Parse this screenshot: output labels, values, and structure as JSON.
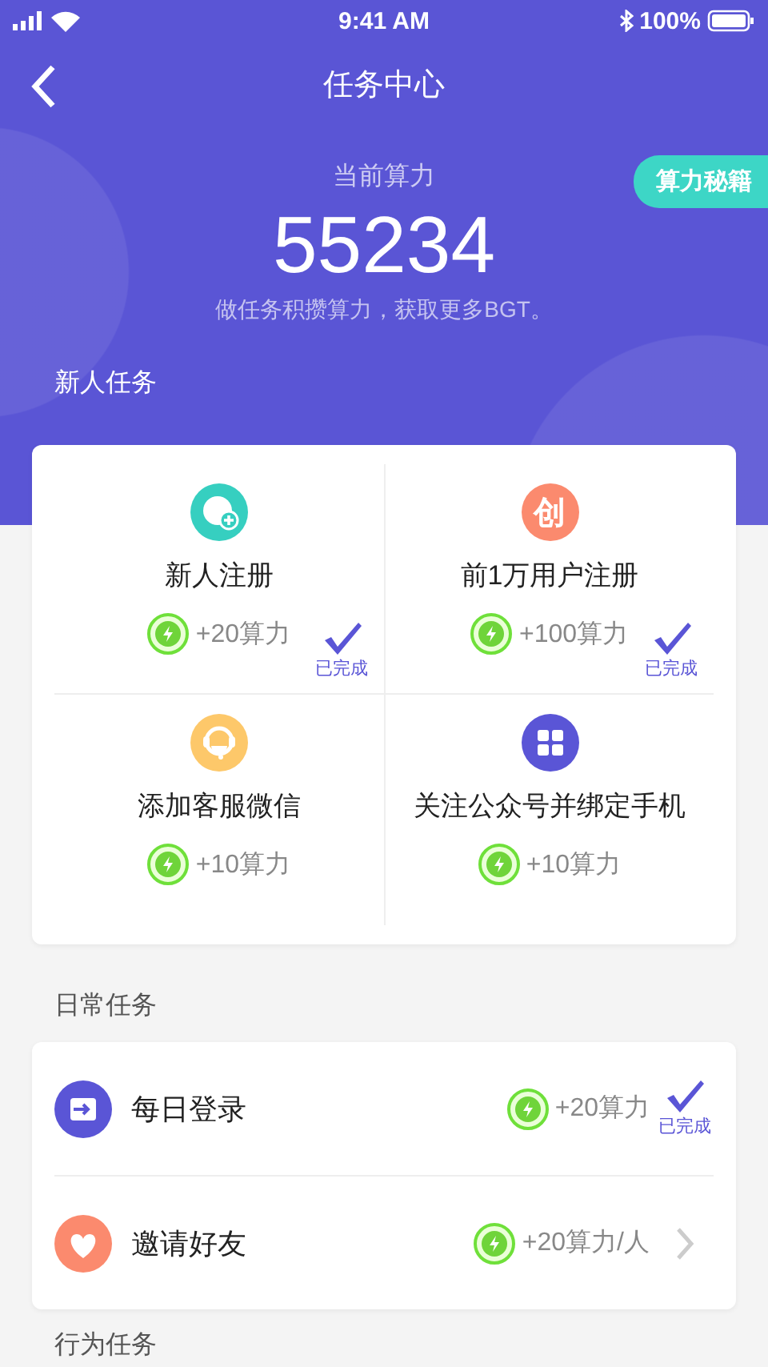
{
  "status_bar": {
    "time": "9:41 AM",
    "battery": "100%"
  },
  "nav": {
    "title": "任务中心"
  },
  "points": {
    "label": "当前算力",
    "value": "55234",
    "hint": "做任务积攒算力，获取更多BGT。",
    "tips_button": "算力秘籍"
  },
  "new_tasks": {
    "title": "新人任务",
    "items": [
      {
        "kind": "add-user",
        "title": "新人注册",
        "reward": "+20算力",
        "completed": true,
        "status": "已完成"
      },
      {
        "kind": "glyph",
        "glyph": "创",
        "title": "前1万用户注册",
        "reward": "+100算力",
        "completed": true,
        "status": "已完成"
      },
      {
        "kind": "headset",
        "title": "添加客服微信",
        "reward": "+10算力",
        "completed": false
      },
      {
        "kind": "grid",
        "title": "关注公众号并绑定手机",
        "reward": "+10算力",
        "completed": false
      }
    ]
  },
  "daily_tasks": {
    "title": "日常任务",
    "items": [
      {
        "kind": "login",
        "title": "每日登录",
        "reward": "+20算力",
        "completed": true,
        "status": "已完成"
      },
      {
        "kind": "heart",
        "title": "邀请好友",
        "reward": "+20算力/人",
        "completed": false
      }
    ]
  },
  "behavior_tasks": {
    "title": "行为任务"
  }
}
